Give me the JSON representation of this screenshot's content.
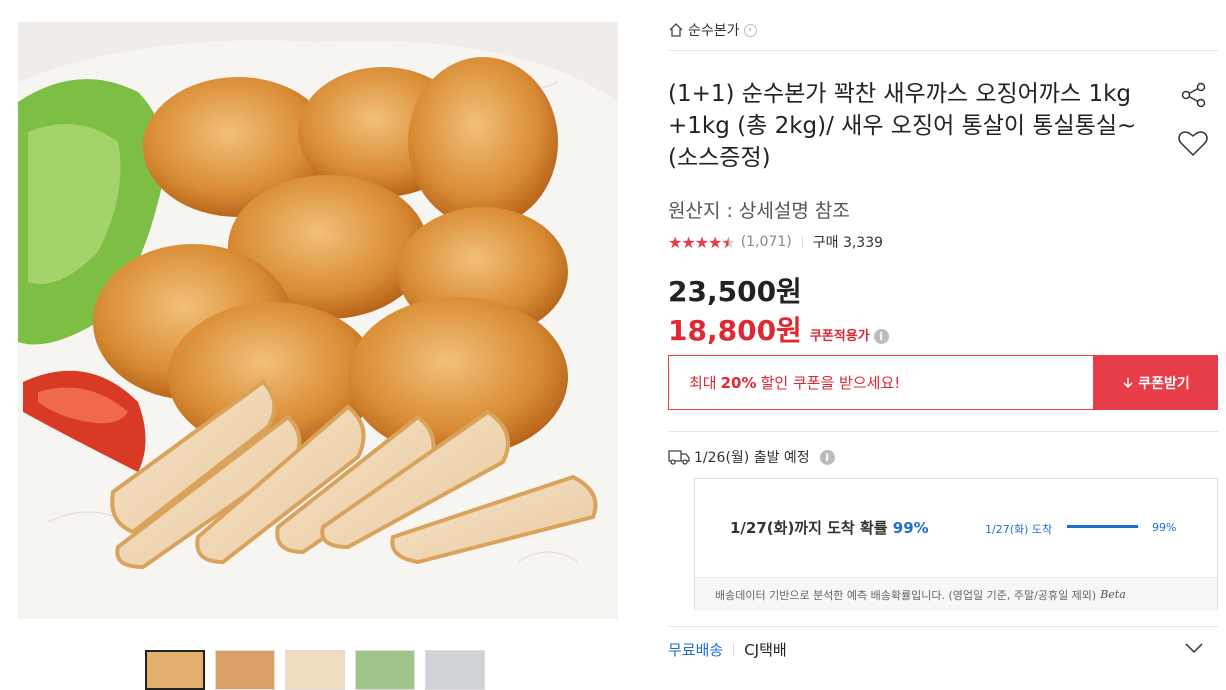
{
  "breadcrumb": {
    "brand": "순수본가"
  },
  "product": {
    "title": "(1+1) 순수본가 꽉찬 새우까스 오징어까스 1kg +1kg (총 2kg)/ 새우 오징어 통살이 통실통실~ (소스증정)",
    "origin": "원산지 : 상세설명 참조",
    "rating": 4.5,
    "review_count": "(1,071)",
    "purchase_count": "구매 3,339",
    "price_original": "23,500원",
    "price_sale": "18,800원",
    "coupon_applied_label": "쿠폰적용가"
  },
  "coupon": {
    "prefix": "최대",
    "percent": "20%",
    "suffix": "할인 쿠폰을 받으세요!",
    "button_label": "쿠폰받기"
  },
  "shipping": {
    "departure": "1/26(월) 출발 예정",
    "probability_text_prefix": "1/27(화)까지 도착 확률",
    "probability_text_pct": "99%",
    "bar_label": "1/27(화) 도착",
    "bar_value": 0.99,
    "bar_pct": "99%",
    "note": "배송데이터 기반으로 분석한 예측 배송확률입니다. (영업일 기준, 주말/공휴일 제외)",
    "beta": "Beta"
  },
  "delivery": {
    "free": "무료배송",
    "carrier": "CJ택배"
  },
  "icons": {
    "home": "home-icon",
    "share": "share-icon",
    "heart": "heart-icon",
    "truck": "truck-icon",
    "info": "info-icon",
    "download": "download-icon",
    "expand": "chevron-down-icon"
  },
  "colors": {
    "accent_red": "#e63d49",
    "sale_red": "#e02833",
    "accent_blue": "#1e6fd0"
  }
}
